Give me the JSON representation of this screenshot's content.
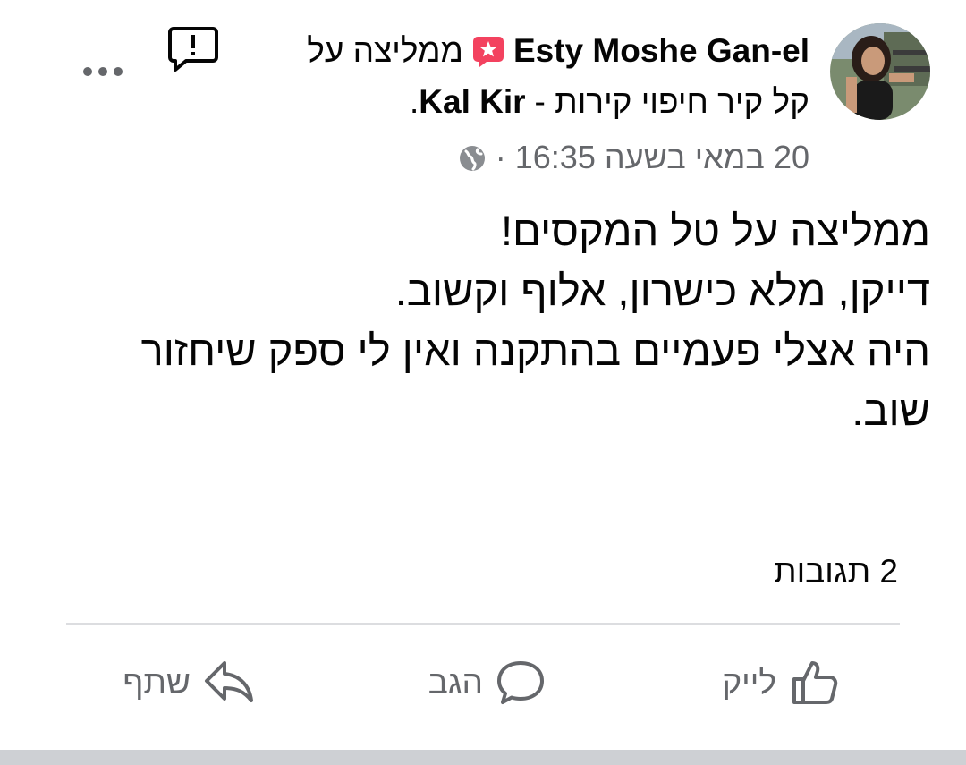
{
  "post": {
    "author_name": "Esty Moshe Gan-el",
    "recommend_text": "ממליצה על",
    "page_name_hebrew": "קל קיר חיפוי קירות -",
    "page_name_english": "Kal Kir",
    "page_name_suffix": ".",
    "timestamp": "20 במאי בשעה 16:35 ·",
    "text_lines": [
      "ממליצה על טל המקסים!",
      "דייקן, מלא כישרון, אלוף וקשוב.",
      "היה אצלי פעמיים בהתקנה ואין לי ספק שיחזור",
      "שוב."
    ],
    "comments_count": "2 תגובות"
  },
  "actions": {
    "like_label": "לייק",
    "comment_label": "הגב",
    "share_label": "שתף"
  },
  "icons": {
    "recommend": "recommend-icon",
    "globe": "globe-icon",
    "report": "report-icon",
    "more": "more-icon",
    "like": "like-icon",
    "comment": "comment-icon",
    "share": "share-icon"
  },
  "colors": {
    "text": "#050505",
    "secondary": "#65676b",
    "recommend_badge": "#f3425f",
    "divider": "#dcdde0",
    "bottom_bar": "#ced0d4"
  }
}
